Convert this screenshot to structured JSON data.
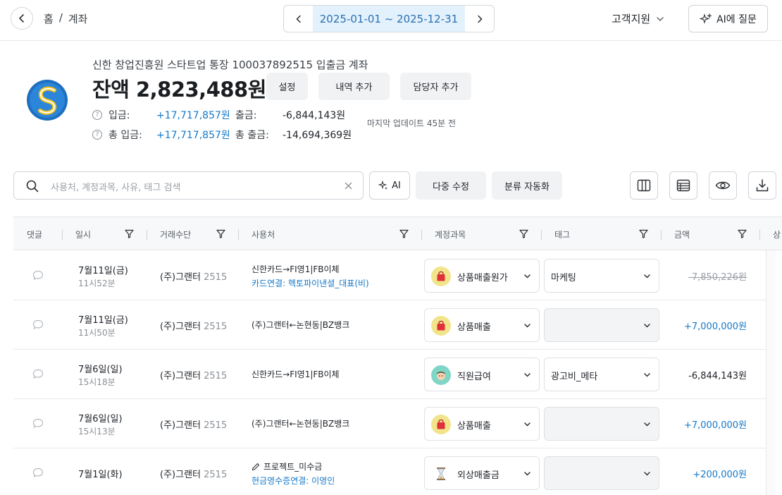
{
  "breadcrumb": {
    "home": "홈",
    "separator": "/",
    "current": "계좌"
  },
  "date_range": {
    "label": "2025-01-01 ~ 2025-12-31"
  },
  "support": {
    "label": "고객지원"
  },
  "ai_ask": {
    "label": "AI에 질문"
  },
  "account": {
    "name": "신한 창업진흥원 스타트업 통장 100037892515 입출금 계좌",
    "balance": "잔액 2,823,488원",
    "buttons": {
      "settings": "설정",
      "add_history": "내역 추가",
      "add_manager": "담당자 추가"
    },
    "stats": {
      "deposit_label": "입금:",
      "deposit_value": "+17,717,857원",
      "withdraw_label": "출금:",
      "withdraw_value": "-6,844,143원",
      "total_deposit_label": "총 입금:",
      "total_deposit_value": "+17,717,857원",
      "total_withdraw_label": "총 출금:",
      "total_withdraw_value": "-14,694,369원"
    },
    "last_update": "마지막 업데이트 45분 전"
  },
  "toolbar": {
    "search_placeholder": "사용처, 계정과목, 사유, 태그 검색",
    "ai_label": "AI",
    "bulk_edit_label": "다중 수정",
    "auto_classify_label": "분류 자동화"
  },
  "table": {
    "headers": {
      "comment": "댓글",
      "date": "일시",
      "method": "거래수단",
      "merchant": "사용처",
      "category": "계정과목",
      "tag": "태그",
      "amount": "금액",
      "extra": "상"
    },
    "rows": [
      {
        "date": "7월11일(금)",
        "time": "11시52분",
        "method": "(주)그랜터",
        "method_acct": "2515",
        "desc": "신한카드→FI영1|FB이체",
        "desc_link": "카드연결: 헥토파이낸셜_대표(비)",
        "category": "상품매출원가",
        "category_icon": "shopping-bag-icon",
        "tag": "마케팅",
        "amount": "-7,850,226원"
      },
      {
        "date": "7월11일(금)",
        "time": "11시50분",
        "method": "(주)그랜터",
        "method_acct": "2515",
        "desc": "(주)그랜터←논현동|BZ뱅크",
        "desc_link": "",
        "category": "상품매출",
        "category_icon": "shopping-bag-icon",
        "tag": "",
        "amount": "+7,000,000원"
      },
      {
        "date": "7월6일(일)",
        "time": "15시18분",
        "method": "(주)그랜터",
        "method_acct": "2515",
        "desc": "신한카드→FI영1|FB이체",
        "desc_link": "",
        "category": "직원급여",
        "category_icon": "employee-face-icon",
        "tag": "광고비_메타",
        "amount": "-6,844,143원"
      },
      {
        "date": "7월6일(일)",
        "time": "15시13분",
        "method": "(주)그랜터",
        "method_acct": "2515",
        "desc": "(주)그랜터←논현동|BZ뱅크",
        "desc_link": "",
        "category": "상품매출",
        "category_icon": "shopping-bag-icon",
        "tag": "",
        "amount": "+7,000,000원"
      },
      {
        "date": "7월1일(화)",
        "time": "",
        "method": "(주)그랜터",
        "method_acct": "2515",
        "desc": "프로젝트_미수금",
        "desc_link": "현금영수증연결: 이영인",
        "category": "외상매출금",
        "category_icon": "hourglass-icon",
        "tag": "",
        "amount": "+200,000원"
      }
    ]
  },
  "colors": {
    "accent_blue": "#1478c9",
    "date_bg": "#e3f1fc",
    "bag_red": "#e0303a",
    "icon_yellow": "#f2e48a",
    "icon_teal": "#7fd6c6"
  }
}
